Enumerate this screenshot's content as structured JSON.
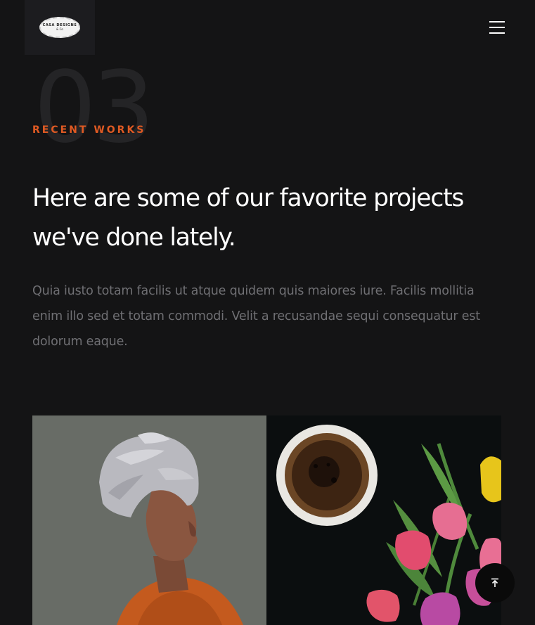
{
  "header": {
    "logo": {
      "title": "CASA DESIGNS",
      "sub": "& Co"
    },
    "menu_icon": "hamburger-icon"
  },
  "intro": {
    "section_number": "03",
    "eyebrow": "RECENT WORKS",
    "headline": "Here are some of our favorite projects we've done lately.",
    "lead": "Quia iusto totam facilis ut atque quidem quis maiores iure. Facilis mollitia enim illo sed et totam commodi. Velit a recusandae sequi consequatur est dolorum eaque."
  },
  "works": [
    {
      "image": "portrait-woman-head-wrap"
    },
    {
      "image": "coffee-and-tulips"
    }
  ],
  "back_to_top_icon": "arrow-up-to-line-icon",
  "colors": {
    "background": "#141415",
    "accent": "#e05a23",
    "text": "#ffffff",
    "muted": "#6f6f73"
  }
}
